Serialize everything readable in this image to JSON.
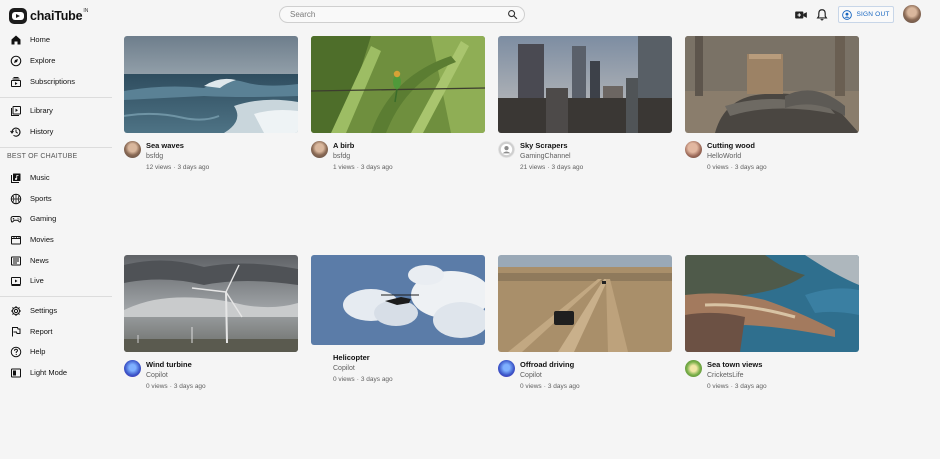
{
  "header": {
    "logo_text": "chaiTube",
    "logo_sup": "IN",
    "search_placeholder": "Search",
    "sign_in_label": "SIGN OUT"
  },
  "sidebar": {
    "primary": [
      {
        "label": "Home",
        "icon": "home-icon"
      },
      {
        "label": "Explore",
        "icon": "explore-icon"
      },
      {
        "label": "Subscriptions",
        "icon": "subscriptions-icon"
      }
    ],
    "library": [
      {
        "label": "Library",
        "icon": "library-icon"
      },
      {
        "label": "History",
        "icon": "history-icon"
      }
    ],
    "section_title": "BEST OF CHAITUBE",
    "best": [
      {
        "label": "Music",
        "icon": "music-icon"
      },
      {
        "label": "Sports",
        "icon": "sports-icon"
      },
      {
        "label": "Gaming",
        "icon": "gaming-icon"
      },
      {
        "label": "Movies",
        "icon": "movies-icon"
      },
      {
        "label": "News",
        "icon": "news-icon"
      },
      {
        "label": "Live",
        "icon": "live-icon"
      }
    ],
    "settings": [
      {
        "label": "Settings",
        "icon": "settings-icon"
      },
      {
        "label": "Report",
        "icon": "flag-icon"
      },
      {
        "label": "Help",
        "icon": "help-icon"
      },
      {
        "label": "Light Mode",
        "icon": "light-mode-icon"
      }
    ]
  },
  "videos": [
    {
      "title": "Sea waves",
      "channel": "bsfdg",
      "views": "12 views",
      "age": "3 days ago"
    },
    {
      "title": "A birb",
      "channel": "bsfdg",
      "views": "1 views",
      "age": "3 days ago"
    },
    {
      "title": "Sky Scrapers",
      "channel": "GamingChannel",
      "views": "21 views",
      "age": "3 days ago"
    },
    {
      "title": "Cutting wood",
      "channel": "HelloWorld",
      "views": "0 views",
      "age": "3 days ago"
    },
    {
      "title": "Wind turbine",
      "channel": "Copilot",
      "views": "0 views",
      "age": "3 days ago"
    },
    {
      "title": "Helicopter",
      "channel": "Copilot",
      "views": "0 views",
      "age": "3 days ago"
    },
    {
      "title": "Offroad driving",
      "channel": "Copilot",
      "views": "0 views",
      "age": "3 days ago"
    },
    {
      "title": "Sea town views",
      "channel": "CricketsLife",
      "views": "0 views",
      "age": "3 days ago"
    }
  ]
}
